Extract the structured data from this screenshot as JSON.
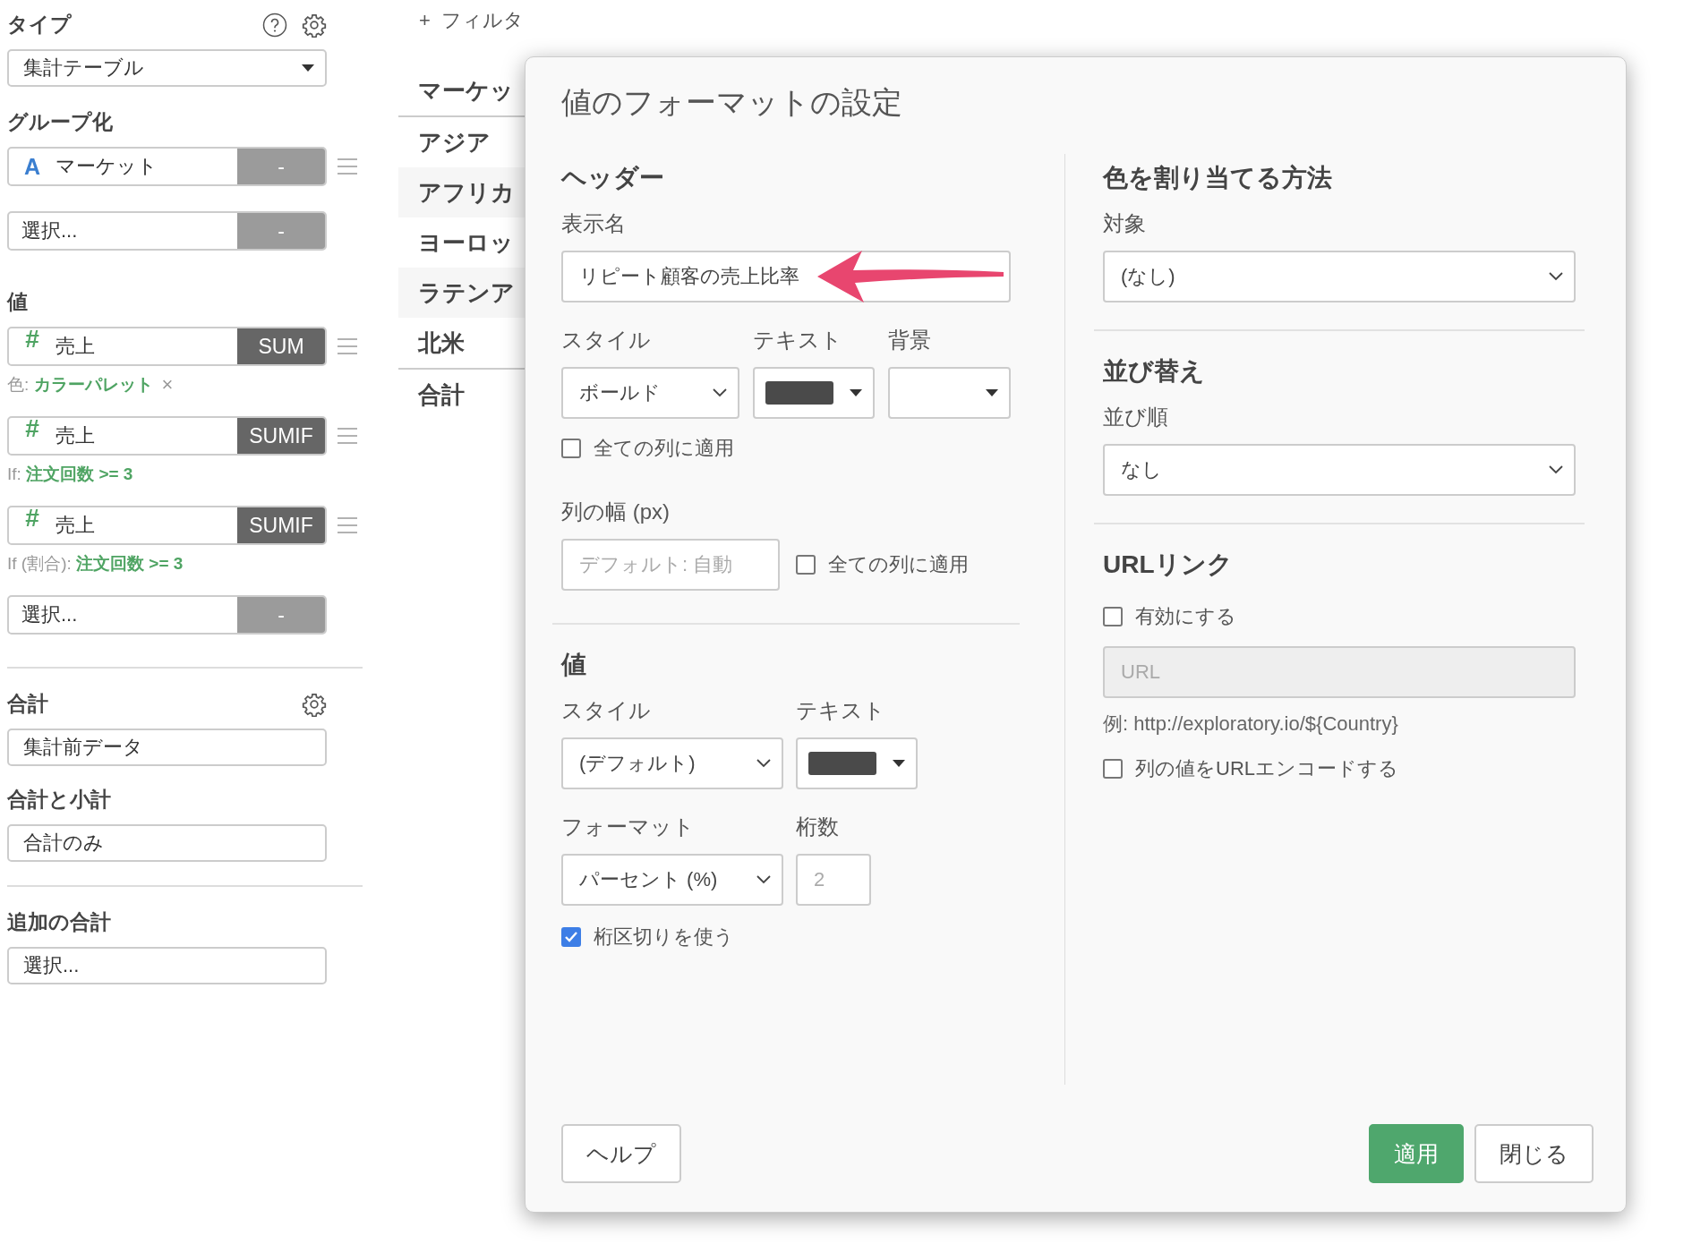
{
  "sidebar": {
    "type": {
      "label": "タイプ",
      "value": "集計テーブル"
    },
    "grouping": {
      "label": "グループ化",
      "items": [
        {
          "kind": "column",
          "type_icon": "A",
          "text": "マーケット",
          "button": "-",
          "button_dark": false
        },
        {
          "kind": "empty",
          "text": "選択...",
          "button": "-",
          "button_dark": false
        }
      ]
    },
    "values": {
      "label": "値",
      "items": [
        {
          "kind": "column",
          "type_icon": "#",
          "text": "売上",
          "button": "SUM",
          "button_dark": true,
          "caption": "色: **カラーパレット**",
          "remove": "×"
        },
        {
          "kind": "column",
          "type_icon": "#",
          "text": "売上",
          "button": "SUMIF",
          "button_dark": true,
          "caption": "If: **注文回数 >= 3**"
        },
        {
          "kind": "column",
          "type_icon": "#",
          "text": "売上",
          "button": "SUMIF",
          "button_dark": true,
          "caption": "If (割合): **注文回数 >= 3**"
        },
        {
          "kind": "empty",
          "text": "選択...",
          "button": "-",
          "button_dark": false
        }
      ]
    },
    "totals": [
      {
        "label": "合計",
        "value": "集計前データ",
        "gear": true,
        "divider_before": true
      },
      {
        "label": "合計と小計",
        "value": "合計のみ",
        "gear": false,
        "divider_before": false
      },
      {
        "label": "追加の合計",
        "value": "選択...",
        "gear": false,
        "divider_before": true
      }
    ]
  },
  "table": {
    "add_filter": {
      "icon": "+",
      "label": "フィルタ"
    },
    "header": "マーケッ",
    "rows": [
      "アジア",
      "アフリカ",
      "ヨーロッ",
      "ラテンア",
      "北米"
    ],
    "total": "合計"
  },
  "dialog": {
    "title": "値のフォーマットの設定",
    "header_section": {
      "heading": "ヘッダー",
      "display_name_label": "表示名",
      "display_name_value": "リピート顧客の売上比率",
      "style_label": "スタイル",
      "style_value": "ボールド",
      "text_label": "テキスト",
      "background_label": "背景",
      "apply_all": {
        "label": "全ての列に適用",
        "checked": false
      },
      "width_label": "列の幅 (px)",
      "width_placeholder": "デフォルト: 自動",
      "width_apply_all": {
        "label": "全ての列に適用",
        "checked": false
      }
    },
    "value_section": {
      "heading": "値",
      "style_label": "スタイル",
      "style_value": "(デフォルト)",
      "text_label": "テキスト",
      "format_label": "フォーマット",
      "format_value": "パーセント (%)",
      "digits_label": "桁数",
      "digits_placeholder": "2",
      "separator": {
        "label": "桁区切りを使う",
        "checked": true
      }
    },
    "color_section": {
      "heading": "色を割り当てる方法",
      "target_label": "対象",
      "target_value": "(なし)"
    },
    "sort_section": {
      "heading": "並び替え",
      "order_label": "並び順",
      "order_value": "なし"
    },
    "url_section": {
      "heading": "URLリンク",
      "enable": {
        "label": "有効にする",
        "checked": false
      },
      "url_placeholder": "URL",
      "url_disabled": true,
      "example": "例: http://exploratory.io/${Country}",
      "encode": {
        "label": "列の値をURLエンコードする",
        "checked": false
      }
    },
    "buttons": [
      {
        "label": "ヘルプ",
        "kind": "default"
      },
      {
        "label": "適用",
        "kind": "primary"
      },
      {
        "label": "閉じる",
        "kind": "default"
      }
    ]
  }
}
